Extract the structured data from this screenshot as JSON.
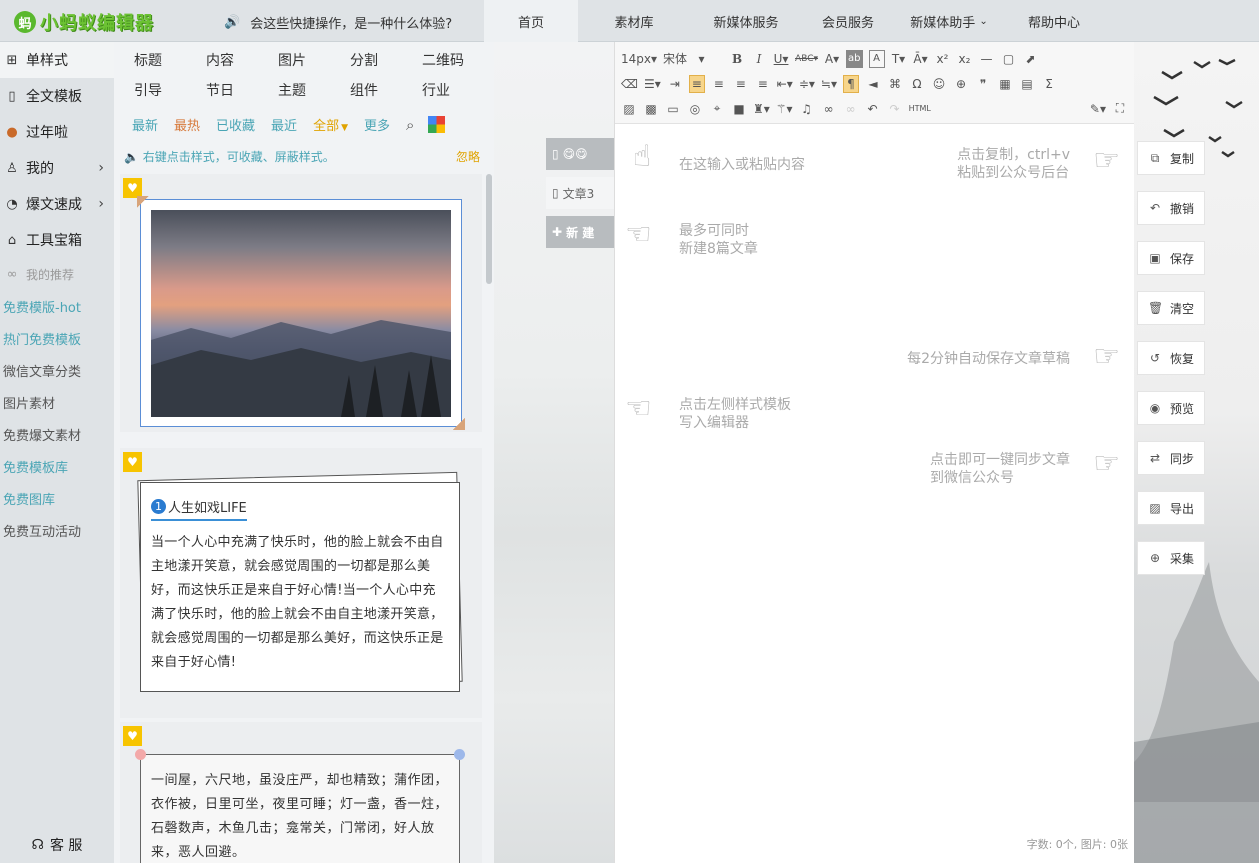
{
  "app": {
    "logo_mark": "蚂",
    "logo_text": "小蚂蚁编辑器",
    "notice": "会这些快捷操作，是一种什么体验?"
  },
  "topnav": [
    {
      "label": "首页"
    },
    {
      "label": "素材库"
    },
    {
      "label": "新媒体服务"
    },
    {
      "label": "会员服务"
    },
    {
      "label": "新媒体助手"
    },
    {
      "label": "帮助中心"
    }
  ],
  "leftnav": {
    "items": [
      {
        "label": "单样式",
        "icon": "grid-icon"
      },
      {
        "label": "全文模板",
        "icon": "template-icon"
      },
      {
        "label": "过年啦",
        "icon": "lantern-icon"
      },
      {
        "label": "我的",
        "icon": "user-icon"
      },
      {
        "label": "爆文速成",
        "icon": "speed-icon"
      },
      {
        "label": "工具宝箱",
        "icon": "toolbox-icon"
      }
    ],
    "recommend": "我的推荐",
    "links": [
      {
        "label": "免费模版-hot"
      },
      {
        "label": "热门免费模板"
      },
      {
        "label": "微信文章分类"
      },
      {
        "label": "图片素材"
      },
      {
        "label": "免费爆文素材"
      },
      {
        "label": "免费模板库"
      },
      {
        "label": "免费图库"
      },
      {
        "label": "免费互动活动"
      }
    ],
    "service": "客 服"
  },
  "categories": {
    "row1": [
      "标题",
      "内容",
      "图片",
      "分割",
      "二维码"
    ],
    "row2": [
      "引导",
      "节日",
      "主题",
      "组件",
      "行业"
    ]
  },
  "filters": {
    "items": [
      "最新",
      "最热",
      "已收藏",
      "最近",
      "全部",
      "更多"
    ]
  },
  "tip": {
    "text": "右键点击样式，可收藏、屏蔽样式。",
    "ignore": "忽略"
  },
  "cards": {
    "card2": {
      "num": "1",
      "title": "人生如戏LIFE",
      "body": "当一个人心中充满了快乐时，他的脸上就会不由自主地漾开笑意，就会感觉周围的一切都是那么美好，而这快乐正是来自于好心情!当一个人心中充满了快乐时，他的脸上就会不由自主地漾开笑意，就会感觉周围的一切都是那么美好，而这快乐正是来自于好心情!"
    },
    "card3": {
      "body": "一间屋，六尺地，虽没庄严，却也精致；蒲作团，衣作被，日里可坐，夜里可睡；灯一盏，香一炷，石磬数声，木鱼几击；龛常关，门常闭，好人放来，恶人回避。"
    }
  },
  "doctabs": [
    {
      "label": "😋😋"
    },
    {
      "label": "文章3"
    },
    {
      "label": "新 建"
    }
  ],
  "toolbar": {
    "font_size": "14px",
    "font_family": "宋体",
    "html_label": "HTML"
  },
  "editor_hints": {
    "paste": "在这输入或粘贴内容",
    "copy_line1": "点击复制，ctrl+v",
    "copy_line2": "粘贴到公众号后台",
    "multi_line1": "最多可同时",
    "multi_line2": "新建8篇文章",
    "autosave": "每2分钟自动保存文章草稿",
    "template_line1": "点击左侧样式模板",
    "template_line2": "写入编辑器",
    "sync_line1": "点击即可一键同步文章",
    "sync_line2": "到微信公众号",
    "counter": "字数: 0个, 图片: 0张"
  },
  "side_buttons": [
    {
      "label": "复制",
      "icon": "copy-icon"
    },
    {
      "label": "撤销",
      "icon": "undo-icon"
    },
    {
      "label": "保存",
      "icon": "save-icon"
    },
    {
      "label": "清空",
      "icon": "trash-icon"
    },
    {
      "label": "恢复",
      "icon": "restore-icon"
    },
    {
      "label": "预览",
      "icon": "eye-icon"
    },
    {
      "label": "同步",
      "icon": "sync-icon"
    },
    {
      "label": "导出",
      "icon": "export-icon"
    },
    {
      "label": "采集",
      "icon": "search-plus-icon"
    }
  ]
}
